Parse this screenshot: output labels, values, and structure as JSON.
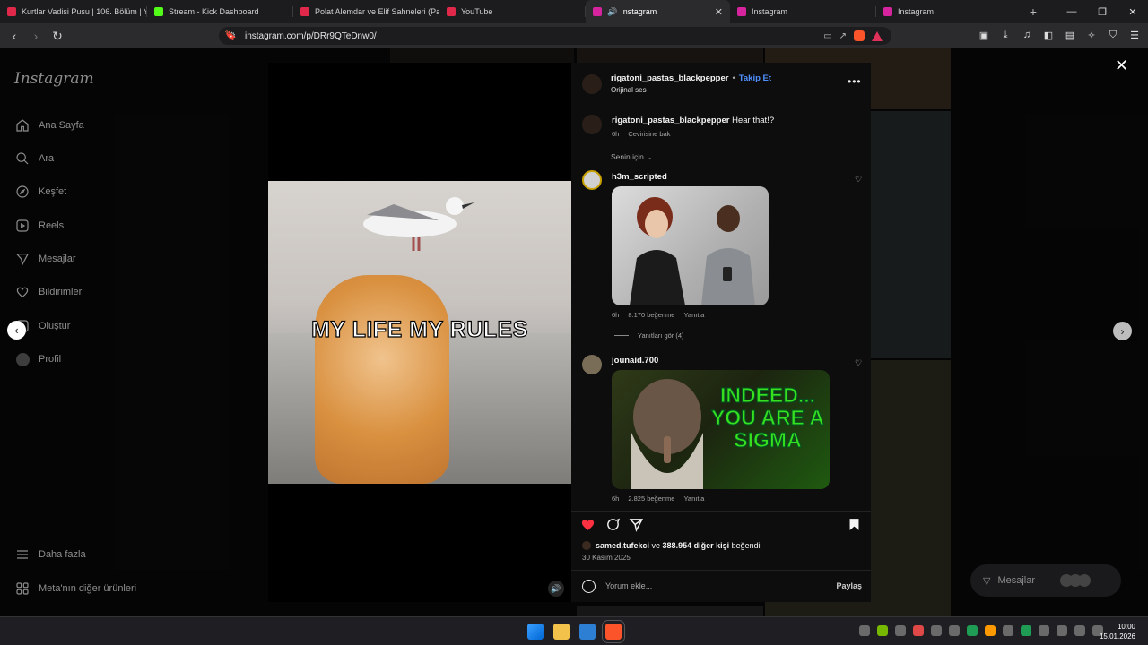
{
  "browser": {
    "tabs": [
      {
        "label": "Kurtlar Vadisi Pusu | 106. Bölüm | Yü",
        "favicon_color": "#e0284b"
      },
      {
        "label": "Stream - Kick Dashboard",
        "favicon_color": "#53fc18"
      },
      {
        "label": "Polat Alemdar ve Elif Sahneleri (Part",
        "favicon_color": "#e0284b"
      },
      {
        "label": "YouTube",
        "favicon_color": "#e0284b"
      },
      {
        "label": "Instagram",
        "favicon_color": "#d6249f",
        "active": true
      },
      {
        "label": "Instagram",
        "favicon_color": "#d6249f"
      },
      {
        "label": "Instagram",
        "favicon_color": "#d6249f"
      }
    ],
    "new_tab": "+",
    "url": "instagram.com/p/DRr9QTeDnw0/"
  },
  "sidebar": {
    "logo": "Instagram",
    "items": [
      {
        "label": "Ana Sayfa",
        "icon": "home-icon"
      },
      {
        "label": "Ara",
        "icon": "search-icon"
      },
      {
        "label": "Keşfet",
        "icon": "compass-icon"
      },
      {
        "label": "Reels",
        "icon": "reels-icon"
      },
      {
        "label": "Mesajlar",
        "icon": "send-icon"
      },
      {
        "label": "Bildirimler",
        "icon": "heart-icon"
      },
      {
        "label": "Oluştur",
        "icon": "plus-icon"
      },
      {
        "label": "Profil",
        "icon": "avatar-icon"
      }
    ],
    "more": "Daha fazla",
    "meta": "Meta'nın diğer ürünleri"
  },
  "video": {
    "caption": "MY LIFE MY RULES"
  },
  "post": {
    "username": "rigatoni_pastas_blackpepper",
    "follow": "Takip Et",
    "audio": "Orijinal ses",
    "caption": {
      "user": "rigatoni_pastas_blackpepper",
      "text": "Hear that!?",
      "time": "6h",
      "translate": "Çevirisine bak"
    },
    "filter": "Senin için",
    "comments": [
      {
        "user": "h3m_scripted",
        "time": "6h",
        "likes": "8.170 beğenme",
        "reply": "Yanıtla",
        "view_replies": "Yanıtları gör (4)"
      },
      {
        "user": "jounaid.700",
        "time": "6h",
        "likes": "2.825 beğenme",
        "reply": "Yanıtla",
        "gif_text": "INDEED... YOU ARE A SIGMA"
      }
    ],
    "liked_by_user": "samed.tufekci",
    "liked_by_mid": " ve ",
    "liked_by_others": "388.954 diğer kişi",
    "liked_by_suffix": " beğendi",
    "date": "30 Kasım 2025",
    "comment_placeholder": "Yorum ekle...",
    "share": "Paylaş"
  },
  "messages_pill": "Mesajlar",
  "taskbar": {
    "time": "10:00",
    "date": "15.01.2026"
  }
}
